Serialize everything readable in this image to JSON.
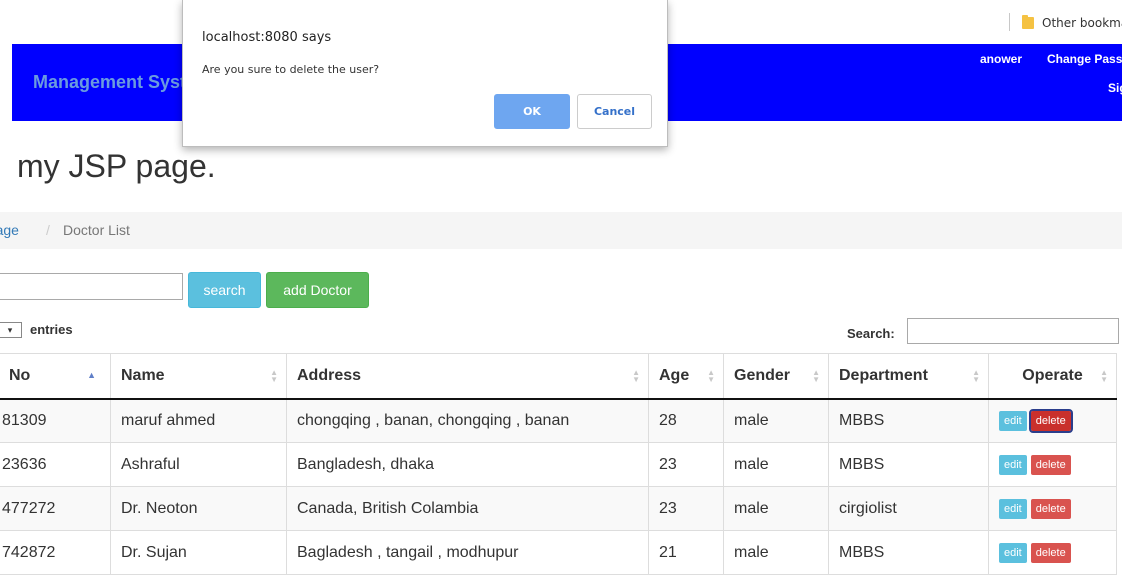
{
  "browser": {
    "bookmark_folder": "Other bookmarks"
  },
  "header": {
    "brand": "Management System",
    "user": "anower",
    "change_password": "Change Password",
    "sign_out": "Sign out"
  },
  "page": {
    "heading": "my JSP page.",
    "breadcrumb": {
      "home": "Home Page",
      "separator": "/",
      "current": "Doctor List"
    }
  },
  "toolbar": {
    "search_placeholder": "",
    "search_label": "search",
    "add_label": "add Doctor"
  },
  "datatable": {
    "length_selector": "▾",
    "entries_label": "entries",
    "filter_label": "Search:",
    "columns": [
      "No",
      "Name",
      "Address",
      "Age",
      "Gender",
      "Department",
      "Operate"
    ],
    "rows": [
      {
        "no": "81309",
        "name": "maruf ahmed",
        "address": "chongqing , banan, chongqing , banan",
        "age": "28",
        "gender": "male",
        "department": "MBBS"
      },
      {
        "no": "23636",
        "name": "Ashraful",
        "address": "Bangladesh, dhaka",
        "age": "23",
        "gender": "male",
        "department": "MBBS"
      },
      {
        "no": "477272",
        "name": "Dr. Neoton",
        "address": "Canada, British Colambia",
        "age": "23",
        "gender": "male",
        "department": "cirgiolist"
      },
      {
        "no": "742872",
        "name": "Dr. Sujan",
        "address": "Bagladesh , tangail , modhupur",
        "age": "21",
        "gender": "male",
        "department": "MBBS"
      }
    ],
    "edit_label": "edit",
    "delete_label": "delete"
  },
  "dialog": {
    "title": "localhost:8080 says",
    "message": "Are you sure to delete the user?",
    "ok": "OK",
    "cancel": "Cancel"
  },
  "colors": {
    "header_bg": "#0000ff",
    "brand_text": "#6b9bdf",
    "info_button": "#5bc0de",
    "success_button": "#5cb85c",
    "danger_button": "#d9534f",
    "dialog_ok": "#6ea6f0"
  }
}
